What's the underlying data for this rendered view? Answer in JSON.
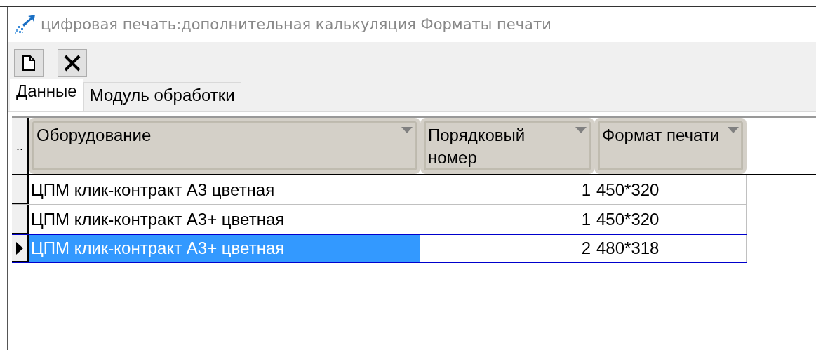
{
  "window": {
    "title": "цифровая печать:дополнительная калькуляция Форматы печати"
  },
  "toolbar": [
    {
      "kind": "new"
    },
    {
      "kind": "delete"
    }
  ],
  "tabs": [
    {
      "label": "Данные",
      "selected": true
    },
    {
      "label": "Модуль обработки",
      "selected": false
    }
  ],
  "table": {
    "indicator_header": "..",
    "columns": [
      {
        "label": "Оборудование",
        "kind": "text"
      },
      {
        "label": "Порядковый номер",
        "kind": "number"
      },
      {
        "label": "Формат печати",
        "kind": "text"
      }
    ],
    "rows": [
      {
        "cells": [
          "ЦПМ клик-контракт А3 цветная",
          "1",
          "450*320"
        ],
        "selected": false
      },
      {
        "cells": [
          "ЦПМ клик-контракт А3+ цветная",
          "1",
          "450*320"
        ],
        "selected": false
      },
      {
        "cells": [
          "ЦПМ клик-контракт А3+ цветная",
          "2",
          "480*318"
        ],
        "selected": true
      }
    ]
  }
}
